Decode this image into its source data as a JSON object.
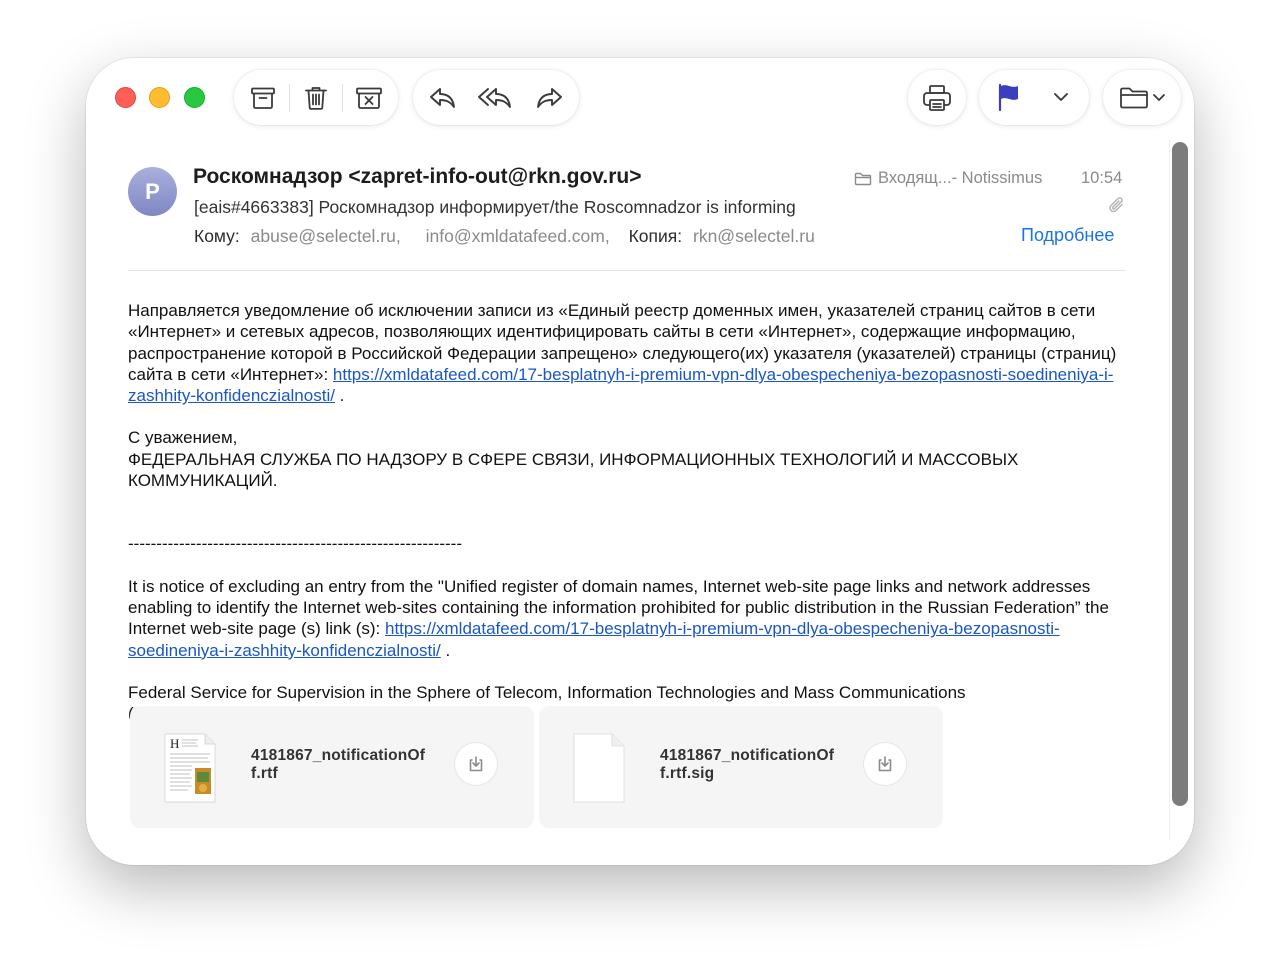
{
  "toolbar": {
    "archive": "archive-icon",
    "trash": "trash-icon",
    "junk": "junk-icon",
    "reply": "reply-icon",
    "reply_all": "reply-all-icon",
    "forward": "forward-icon",
    "print": "printer-icon",
    "flag": "flag-icon",
    "flag_color": "#3b3fbf",
    "move": "folder-icon"
  },
  "message": {
    "avatar_letter": "Р",
    "from": "Роскомнадзор <zapret-info-out@rkn.gov.ru>",
    "subject": "[eais#4663383] Роскомнадзор информирует/the Roscomnadzor is informing",
    "to_label": "Кому:",
    "to": [
      "abuse@selectel.ru,",
      "info@xmldatafeed.com,"
    ],
    "cc_label": "Копия:",
    "cc": "rkn@selectel.ru",
    "mailbox": "Входящ...- Notissimus",
    "time": "10:54",
    "details_link": "Подробнее"
  },
  "body": {
    "ru_para": "Направляется уведомление об исключении записи из «Единый реестр доменных имен, указателей страниц сайтов в сети «Интернет» и сетевых адресов, позволяющих идентифицировать сайты в сети «Интернет», содержащие информацию, распространение которой в Российской Федерации запрещено» следующего(их) указателя (указателей) страницы (страниц) сайта в сети «Интернет»: ",
    "ru_link": "https://xmldatafeed.com/17-besplatnyh-i-premium-vpn-dlya-obespecheniya-bezopasnosti-soedineniya-i-zashhity-konfidenczialnosti/",
    "ru_after": " .",
    "regards": "С уважением,",
    "signature_ru": "ФЕДЕРАЛЬНАЯ СЛУЖБА ПО НАДЗОРУ В СФЕРЕ СВЯЗИ, ИНФОРМАЦИОННЫХ ТЕХНОЛОГИЙ И МАССОВЫХ КОММУНИКАЦИЙ.",
    "divider": "-----------------------------------------------------------",
    "en_para": "It is notice of excluding an entry from the \"Unified register of domain names, Internet web-site page links and network addresses enabling to identify the Internet web-sites containing the information prohibited for public distribution in the Russian Federation” the Internet web-site page (s) link (s): ",
    "en_link": "https://xmldatafeed.com/17-besplatnyh-i-premium-vpn-dlya-obespecheniya-bezopasnosti-soedineniya-i-zashhity-konfidenczialnosti/",
    "en_after": " .",
    "signature_en": "Federal Service for Supervision in the Sphere of Telecom, Information Technologies and Mass Communications (ROSKOMNADZOR)."
  },
  "attachments": [
    {
      "name_line1": "4181867_notificationOf",
      "name_line2": "f.rtf",
      "icon": "rtf-document-icon"
    },
    {
      "name_line1": "4181867_notificationOf",
      "name_line2": "f.rtf.sig",
      "icon": "blank-document-icon"
    }
  ]
}
